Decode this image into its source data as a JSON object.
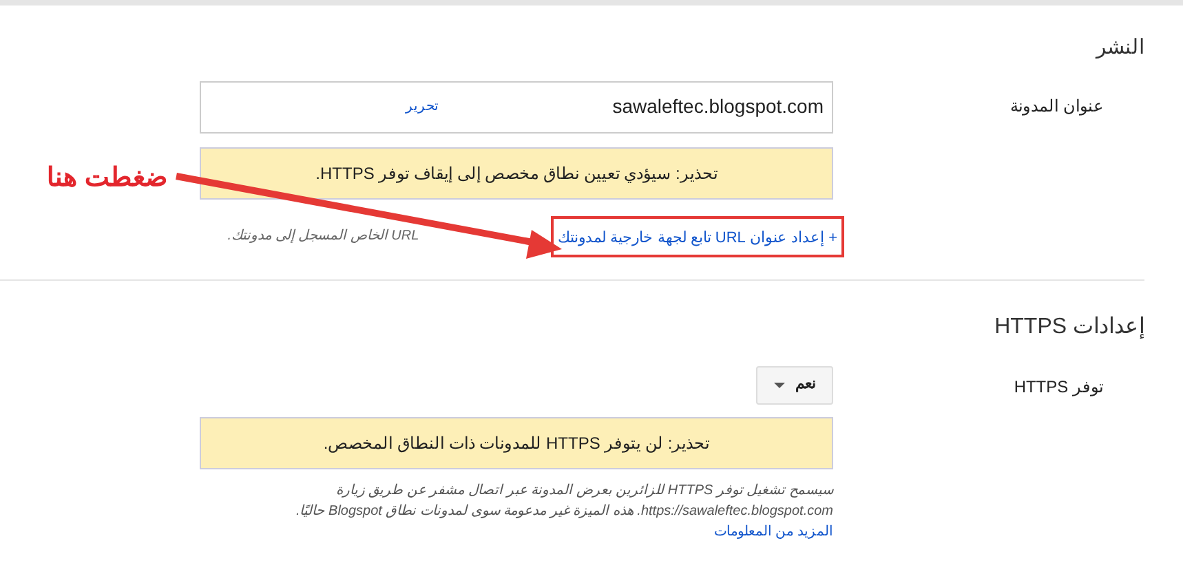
{
  "publishing": {
    "title": "النشر",
    "blog_address": {
      "label": "عنوان المدونة",
      "value": "sawaleftec.blogspot.com",
      "edit_link": "تحرير"
    },
    "warning": "تحذير: سيؤدي تعيين نطاق مخصص إلى إيقاف توفر HTTPS.",
    "setup_link": "+ إعداد عنوان URL تابع لجهة خارجية لمدونتك",
    "hint": "URL الخاص المسجل إلى مدونتك."
  },
  "https": {
    "title": "إعدادات HTTPS",
    "availability": {
      "label": "توفر HTTPS",
      "value": "نعم"
    },
    "warning": "تحذير: لن يتوفر HTTPS للمدونات ذات النطاق المخصص.",
    "description": "سيسمح تشغيل توفر HTTPS للزائرين بعرض المدونة عبر اتصال مشفر عن طريق زيارة https://sawaleftec.blogspot.com. هذه الميزة غير مدعومة سوى لمدونات نطاق Blogspot حاليًا.",
    "more_link": "المزيد من المعلومات"
  },
  "annotation": {
    "text": "ضغطت هنا"
  }
}
